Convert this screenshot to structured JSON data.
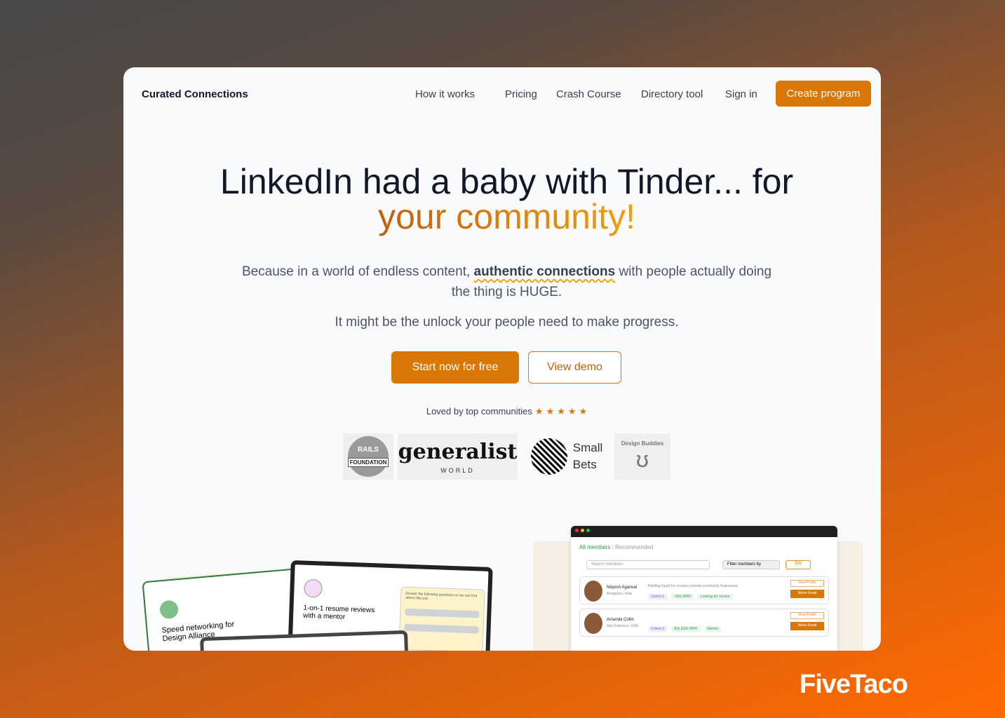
{
  "header": {
    "brand": "Curated Connections",
    "nav": [
      "How it works",
      "Pricing",
      "Crash Course",
      "Directory tool",
      "Sign in"
    ],
    "cta": "Create program"
  },
  "hero": {
    "title_line1": "LinkedIn had a baby with Tinder... for",
    "title_line2": "your community!",
    "sub_before": "Because in a world of endless content,",
    "sub_highlight": "authentic connections",
    "sub_after": "with people actually doing the thing is HUGE.",
    "sub2": "It might be the unlock your people need to make progress.",
    "primary_button": "Start now for free",
    "secondary_button": "View demo",
    "loved": "Loved by top communities",
    "rating": 5
  },
  "logos": {
    "rails_top": "RAILS",
    "rails_bottom": "FOUNDATION",
    "generalist": "generalist",
    "generalist_sub": "WORLD",
    "smallbets_1": "Small",
    "smallbets_2": "Bets",
    "design_buddies": "Design Buddies"
  },
  "left_mockup": {
    "card1": "Speed networking for Design Alliance",
    "card2": "1-on-1 resume reviews with a mentor",
    "form_prompt": "Answer the following questions so we can find others like you"
  },
  "right_mockup": {
    "tabs": [
      "All members",
      "Recommended"
    ],
    "search_placeholder": "Search members",
    "filter": "Filter members by",
    "go": "Go",
    "members": [
      {
        "name": "Nityesh Agarwal",
        "location": "Bengaluru, India",
        "bio": "Building SaaS for creators running community businesses",
        "tags": [
          "Cohort 1",
          "<$1k MRR",
          "Looking for mentor"
        ]
      },
      {
        "name": "Amanda Collin",
        "location": "San Francisco, USA",
        "bio": "",
        "tags": [
          "Cohort 2",
          "$1k-$10k MRR",
          "Mentor"
        ]
      }
    ],
    "view_profile": "View Profile",
    "warm_email": "Warm Email"
  },
  "watermark": "FiveTaco",
  "colors": {
    "accent": "#d97706",
    "text": "#111827"
  }
}
